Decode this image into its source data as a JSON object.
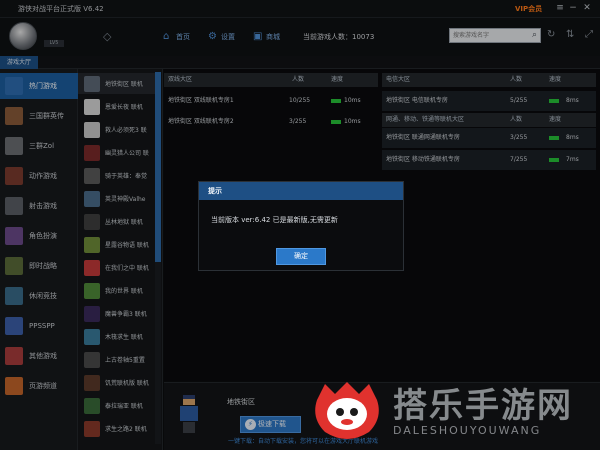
{
  "app": {
    "title": "游侠对战平台正式版 V6.42",
    "vip_label": "VIP会员",
    "level_tag": "LV5"
  },
  "header": {
    "nav": [
      {
        "label": "首页",
        "icon": "home-icon"
      },
      {
        "label": "设置",
        "icon": "gear-icon"
      },
      {
        "label": "商城",
        "icon": "shop-icon"
      }
    ],
    "online_count": "当前游戏人数：10073",
    "search_placeholder": "搜索游戏名字"
  },
  "tabstrip": {
    "active_tab": "游戏大厅"
  },
  "categories": [
    {
      "label": "热门游戏",
      "color": "#2e6db0"
    },
    {
      "label": "三国群英传",
      "color": "#8a5a3a"
    },
    {
      "label": "三群Zol",
      "color": "#6b6e72"
    },
    {
      "label": "动作游戏",
      "color": "#7a3b2e"
    },
    {
      "label": "射击游戏",
      "color": "#5a5f66"
    },
    {
      "label": "角色扮演",
      "color": "#6b4a8a"
    },
    {
      "label": "即时战略",
      "color": "#5a6b3a"
    },
    {
      "label": "休闲竞技",
      "color": "#3a6b8a"
    },
    {
      "label": "PPSSPP",
      "color": "#3c5fa8"
    },
    {
      "label": "其他游戏",
      "color": "#a83c3c"
    },
    {
      "label": "页游频道",
      "color": "#c2642a"
    }
  ],
  "games": [
    {
      "label": "地铁街区 联机",
      "color": "#5f6a78"
    },
    {
      "label": "恩爱长夜 联机",
      "color": "#d7d7d7"
    },
    {
      "label": "救人必须死3 联",
      "color": "#c9c9c9"
    },
    {
      "label": "幽灵猎人公司 联",
      "color": "#7b2a2a"
    },
    {
      "label": "骑于英雄：奉觉",
      "color": "#5a5a5a"
    },
    {
      "label": "英灵神殿Valhe",
      "color": "#4a6b8a"
    },
    {
      "label": "丛林地狱 联机",
      "color": "#3f3f3f"
    },
    {
      "label": "星露谷物语 联机",
      "color": "#6f8c3a"
    },
    {
      "label": "在我们之中 联机",
      "color": "#c23a3a"
    },
    {
      "label": "我的世界 联机",
      "color": "#4f8a3a"
    },
    {
      "label": "魔兽争霸3 联机",
      "color": "#3a2a5a"
    },
    {
      "label": "木筏求生 联机",
      "color": "#3a7a9a"
    },
    {
      "label": "上古卷轴5重置",
      "color": "#4a4a4a"
    },
    {
      "label": "饥荒联机版 联机",
      "color": "#5a3a2a"
    },
    {
      "label": "泰拉瑞亚 联机",
      "color": "#3a6a3a"
    },
    {
      "label": "求生之路2 联机",
      "color": "#8a3a2a"
    }
  ],
  "rooms": {
    "left_table": {
      "headers": [
        "双线大区",
        "人数",
        "速度"
      ],
      "rows": [
        {
          "name": "地铁街区 双线联机专房1",
          "count": "10/255",
          "speed": "10ms"
        },
        {
          "name": "地铁街区 双线联机专房2",
          "count": "3/255",
          "speed": "10ms"
        }
      ]
    },
    "right_table": {
      "headers": [
        "电信大区",
        "人数",
        "速度"
      ],
      "rows": [
        {
          "name": "地铁街区 电信联机专房",
          "count": "5/255",
          "speed": "8ms"
        }
      ]
    },
    "right_table2": {
      "headers": [
        "网通、移动、铁通等联机大区",
        "人数",
        "速度"
      ],
      "rows": [
        {
          "name": "地铁街区 联通网通联机专房",
          "count": "3/255",
          "speed": "8ms"
        },
        {
          "name": "地铁街区 移动铁通联机专房",
          "count": "7/255",
          "speed": "7ms"
        }
      ]
    }
  },
  "bottom": {
    "zone_title": "地铁街区",
    "download_button": "极速下载",
    "hint": "一键下载：自动下载安装，您将可以在游戏大厅联机游戏"
  },
  "dialog": {
    "title": "提示",
    "message": "当前版本 ver:6.42 已是最新版,无需更新",
    "ok_button": "确定"
  },
  "watermark": {
    "text": "搭乐手游网",
    "sub": "DALESHOUYOUWANG"
  }
}
